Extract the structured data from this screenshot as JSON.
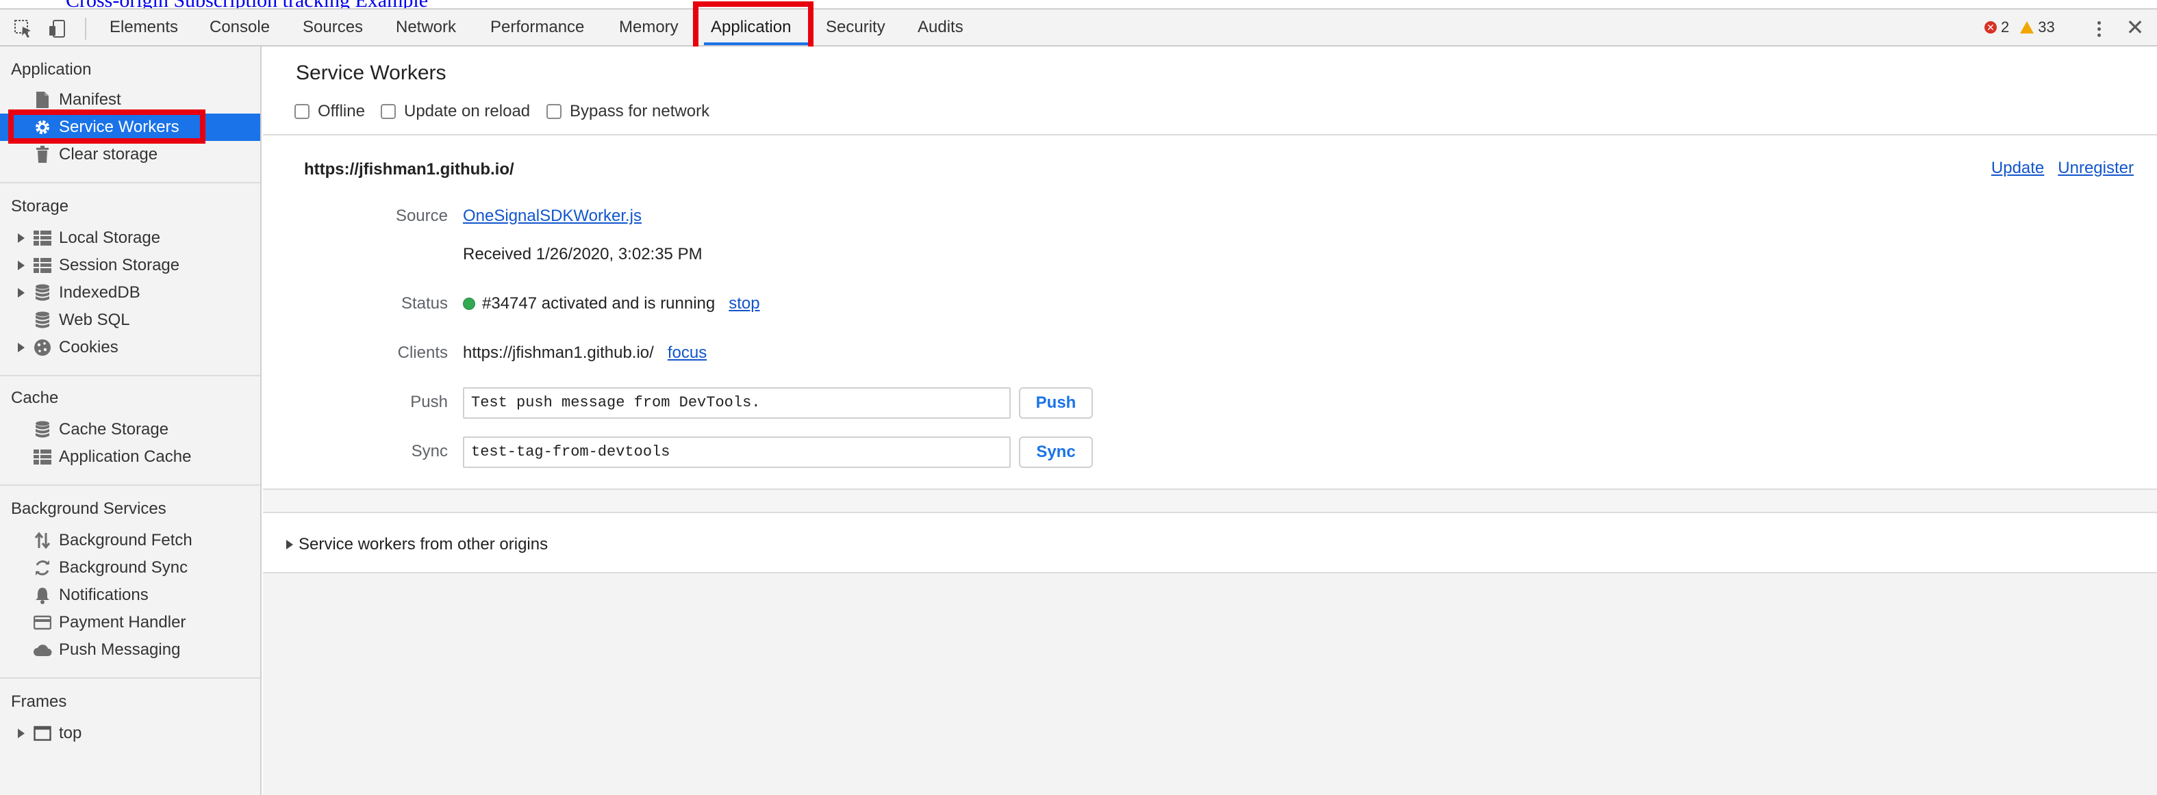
{
  "page": {
    "link_text": "Cross-origin Subscription tracking Example"
  },
  "toolbar": {
    "tabs": [
      "Elements",
      "Console",
      "Sources",
      "Network",
      "Performance",
      "Memory",
      "Application",
      "Security",
      "Audits"
    ],
    "selected_tab": "Application",
    "error_count": "2",
    "warning_count": "33",
    "error_glyph": "✕",
    "close_glyph": "✕"
  },
  "sidebar": {
    "application": {
      "title": "Application",
      "items": [
        {
          "label": "Manifest",
          "icon": "file-icon"
        },
        {
          "label": "Service Workers",
          "icon": "gear-icon",
          "selected": true
        },
        {
          "label": "Clear storage",
          "icon": "trash-icon"
        }
      ]
    },
    "storage": {
      "title": "Storage",
      "items": [
        {
          "label": "Local Storage",
          "icon": "grid-icon"
        },
        {
          "label": "Session Storage",
          "icon": "grid-icon"
        },
        {
          "label": "IndexedDB",
          "icon": "database-icon"
        },
        {
          "label": "Web SQL",
          "icon": "database-icon"
        },
        {
          "label": "Cookies",
          "icon": "cookie-icon"
        }
      ]
    },
    "cache": {
      "title": "Cache",
      "items": [
        {
          "label": "Cache Storage",
          "icon": "database-icon"
        },
        {
          "label": "Application Cache",
          "icon": "grid-icon"
        }
      ]
    },
    "background": {
      "title": "Background Services",
      "items": [
        {
          "label": "Background Fetch",
          "icon": "fetch-arrows-icon"
        },
        {
          "label": "Background Sync",
          "icon": "sync-icon"
        },
        {
          "label": "Notifications",
          "icon": "bell-icon"
        },
        {
          "label": "Payment Handler",
          "icon": "card-icon"
        },
        {
          "label": "Push Messaging",
          "icon": "cloud-icon"
        }
      ]
    },
    "frames": {
      "title": "Frames",
      "items": [
        {
          "label": "top",
          "icon": "frame-icon"
        }
      ]
    }
  },
  "main": {
    "title": "Service Workers",
    "options": [
      "Offline",
      "Update on reload",
      "Bypass for network"
    ],
    "origin": "https://jfishman1.github.io/",
    "update_label": "Update",
    "unregister_label": "Unregister",
    "source_label": "Source",
    "source_file": "OneSignalSDKWorker.js",
    "received": "Received 1/26/2020, 3:02:35 PM",
    "status_label": "Status",
    "status_text": "#34747 activated and is running",
    "stop_label": "stop",
    "status_color": "#34a853",
    "clients_label": "Clients",
    "client_url": "https://jfishman1.github.io/",
    "focus_label": "focus",
    "push_label": "Push",
    "push_value": "Test push message from DevTools.",
    "push_button": "Push",
    "sync_label": "Sync",
    "sync_value": "test-tag-from-devtools",
    "sync_button": "Sync",
    "other_origins": "Service workers from other origins"
  },
  "colors": {
    "accent": "#1a73e8",
    "highlight_box": "#e8000f",
    "link": "#1155cc"
  }
}
